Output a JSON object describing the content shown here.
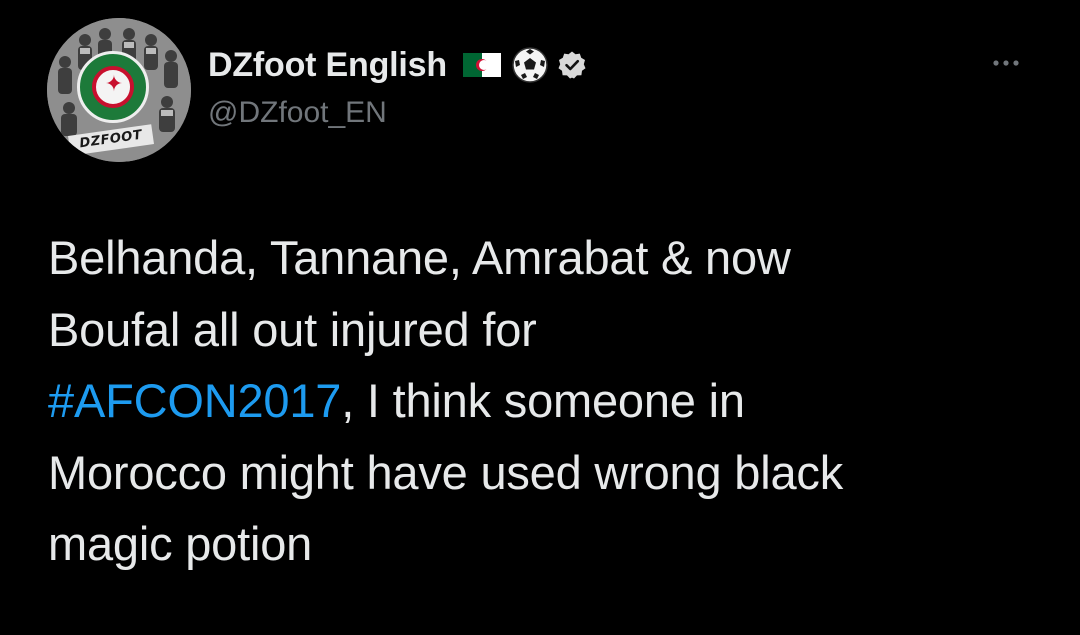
{
  "tweet": {
    "author": {
      "display_name": "DZfoot English",
      "handle": "@DZfoot_EN",
      "avatar_badge_text": "DZFOOT",
      "badges": [
        "algeria-flag-icon",
        "soccer-ball-icon",
        "verified-badge-icon"
      ]
    },
    "more_icon": "more-options-icon",
    "body": {
      "line1": "Belhanda, Tannane, Amrabat & now",
      "line2": "Boufal all out injured for",
      "hashtag": "#AFCON2017",
      "line3_rest": ", I think someone in",
      "line4": "Morocco might have used wrong black",
      "line5": "magic potion"
    }
  },
  "colors": {
    "background": "#000000",
    "text": "#e7e9ea",
    "secondary_text": "#71767b",
    "link": "#1d9bf0"
  }
}
